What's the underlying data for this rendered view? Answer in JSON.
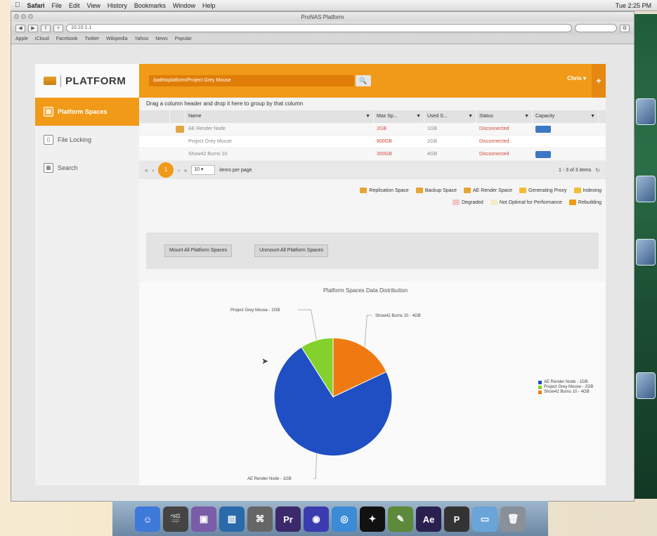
{
  "menubar": {
    "apple": "",
    "items": [
      "Safari",
      "File",
      "Edit",
      "View",
      "History",
      "Bookmarks",
      "Window",
      "Help"
    ],
    "clock": "Tue 2:25 PM"
  },
  "browser": {
    "window_title": "ProNAS Platform",
    "url": "10.10.1.1",
    "bookmarks": [
      "Apple",
      "iCloud",
      "Facebook",
      "Twitter",
      "Wikipedia",
      "Yahoo",
      "News",
      "Popular"
    ]
  },
  "sidebar": {
    "logo": "PLATFORM",
    "items": [
      {
        "label": "Platform Spaces",
        "icon": "▤"
      },
      {
        "label": "File Locking",
        "icon": "▯"
      },
      {
        "label": "Search",
        "icon": "▦"
      }
    ]
  },
  "topbar": {
    "breadcrumb": "/pathtoplatform/Project Grey Mouse",
    "search_icon": "🔍",
    "user": "Chris",
    "plus": "+"
  },
  "grid": {
    "group_hint": "Drag a column header and drop it here to group by that column",
    "columns": [
      "",
      "",
      "Name",
      "Max Sp...",
      "Used S...",
      "Status",
      "Capacity"
    ],
    "rows": [
      {
        "name": "AE Render Node",
        "max": "2GB",
        "used": "1GB",
        "status": "Disconnected",
        "capacity": true,
        "icon": true
      },
      {
        "name": "Project Grey Mouse",
        "max": "800GB",
        "used": "2GB",
        "status": "Disconnected",
        "capacity": false,
        "icon": false
      },
      {
        "name": "Show42 Burns 10",
        "max": "300GB",
        "used": "4GB",
        "status": "Disconnected",
        "capacity": true,
        "icon": false
      }
    ],
    "pager": {
      "first": "«",
      "prev": "‹",
      "current": "1",
      "next": "›",
      "last": "»",
      "per_page": "10",
      "per_page_label": "items per page",
      "summary": "1 - 3 of 3 items",
      "refresh": "↻"
    }
  },
  "legend": {
    "row1": [
      {
        "label": "Replication Space",
        "color": "#e8a533"
      },
      {
        "label": "Backup Space",
        "color": "#e8a533"
      },
      {
        "label": "AE Render Space",
        "color": "#e8a533"
      },
      {
        "label": "Generating Proxy",
        "color": "#f2bd33"
      },
      {
        "label": "Indexing",
        "color": "#f2bd33"
      }
    ],
    "row2": [
      {
        "label": "Degraded",
        "color": "#f3c6c6"
      },
      {
        "label": "Not Optimal for Performance",
        "color": "#f6ebc8"
      },
      {
        "label": "Rebuilding",
        "color": "#f09a18"
      }
    ]
  },
  "actions": {
    "mount": "Mount All Platform Spaces",
    "unmount": "Unmount All Platform Spaces"
  },
  "chart_data": {
    "type": "pie",
    "title": "Platform Spaces Data Distribution",
    "categories": [
      "AE Render Node - 1GB",
      "Project Grey Mouse - 2GB",
      "Show42 Burns 10 - 4GB"
    ],
    "values": [
      73,
      9,
      18
    ],
    "colors": [
      "#1f4fc2",
      "#84d02c",
      "#ef7a12"
    ],
    "slice_labels": [
      "AE Render Node - 1GB",
      "Project Grey Mouse - 2GB",
      "Show42 Burns 10 - 4GB"
    ],
    "legend_position": "right"
  },
  "dock": {
    "icons": [
      {
        "name": "finder",
        "label": "☺",
        "color": "#3d7ad9"
      },
      {
        "name": "clapper",
        "label": "🎬",
        "color": "#444"
      },
      {
        "name": "photos",
        "label": "▣",
        "color": "#7a5ca8"
      },
      {
        "name": "preview",
        "label": "▧",
        "color": "#2b6aaa"
      },
      {
        "name": "screenshot",
        "label": "⌘",
        "color": "#666"
      },
      {
        "name": "premiere",
        "label": "Pr",
        "color": "#3a2a6b"
      },
      {
        "name": "dvd",
        "label": "◉",
        "color": "#3b3bb0"
      },
      {
        "name": "safari",
        "label": "◎",
        "color": "#3c8bd6"
      },
      {
        "name": "motion",
        "label": "✦",
        "color": "#111"
      },
      {
        "name": "migration",
        "label": "✎",
        "color": "#5c8a3a"
      },
      {
        "name": "after-effects",
        "label": "Ae",
        "color": "#2a2050"
      },
      {
        "name": "app-p",
        "label": "P",
        "color": "#333"
      },
      {
        "name": "folder",
        "label": "▭",
        "color": "#6aa4d8"
      },
      {
        "name": "trash",
        "label": "🗑",
        "color": "#8a9098"
      }
    ]
  }
}
